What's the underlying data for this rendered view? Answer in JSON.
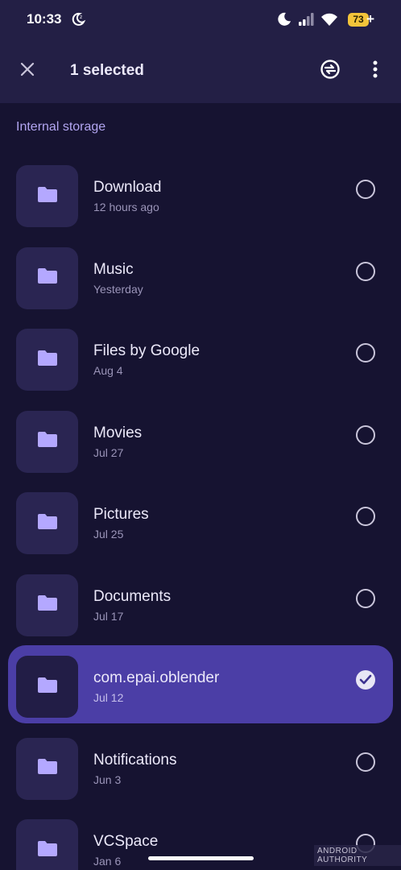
{
  "status_bar": {
    "time": "10:33",
    "battery": "73",
    "battery_plus": "+"
  },
  "app_bar": {
    "selection_title": "1 selected",
    "close_icon": "close-icon",
    "sync_icon": "sync-icon",
    "more_icon": "more-vert-icon"
  },
  "section": {
    "label": "Internal storage"
  },
  "items": [
    {
      "name": "Download",
      "date": "12 hours ago",
      "selected": false
    },
    {
      "name": "Music",
      "date": "Yesterday",
      "selected": false
    },
    {
      "name": "Files by Google",
      "date": "Aug 4",
      "selected": false
    },
    {
      "name": "Movies",
      "date": "Jul 27",
      "selected": false
    },
    {
      "name": "Pictures",
      "date": "Jul 25",
      "selected": false
    },
    {
      "name": "Documents",
      "date": "Jul 17",
      "selected": false
    },
    {
      "name": "com.epai.oblender",
      "date": "Jul 12",
      "selected": true
    },
    {
      "name": "Notifications",
      "date": "Jun 3",
      "selected": false
    },
    {
      "name": "VCSpace",
      "date": "Jan 6",
      "selected": false
    }
  ],
  "watermark": "ANDROID AUTHORITY",
  "colors": {
    "background": "#161331",
    "top_bar": "#231F45",
    "accent": "#B3A6F2",
    "selected_row": "#4B3EA6",
    "folder_icon": "#B4A8FF"
  }
}
